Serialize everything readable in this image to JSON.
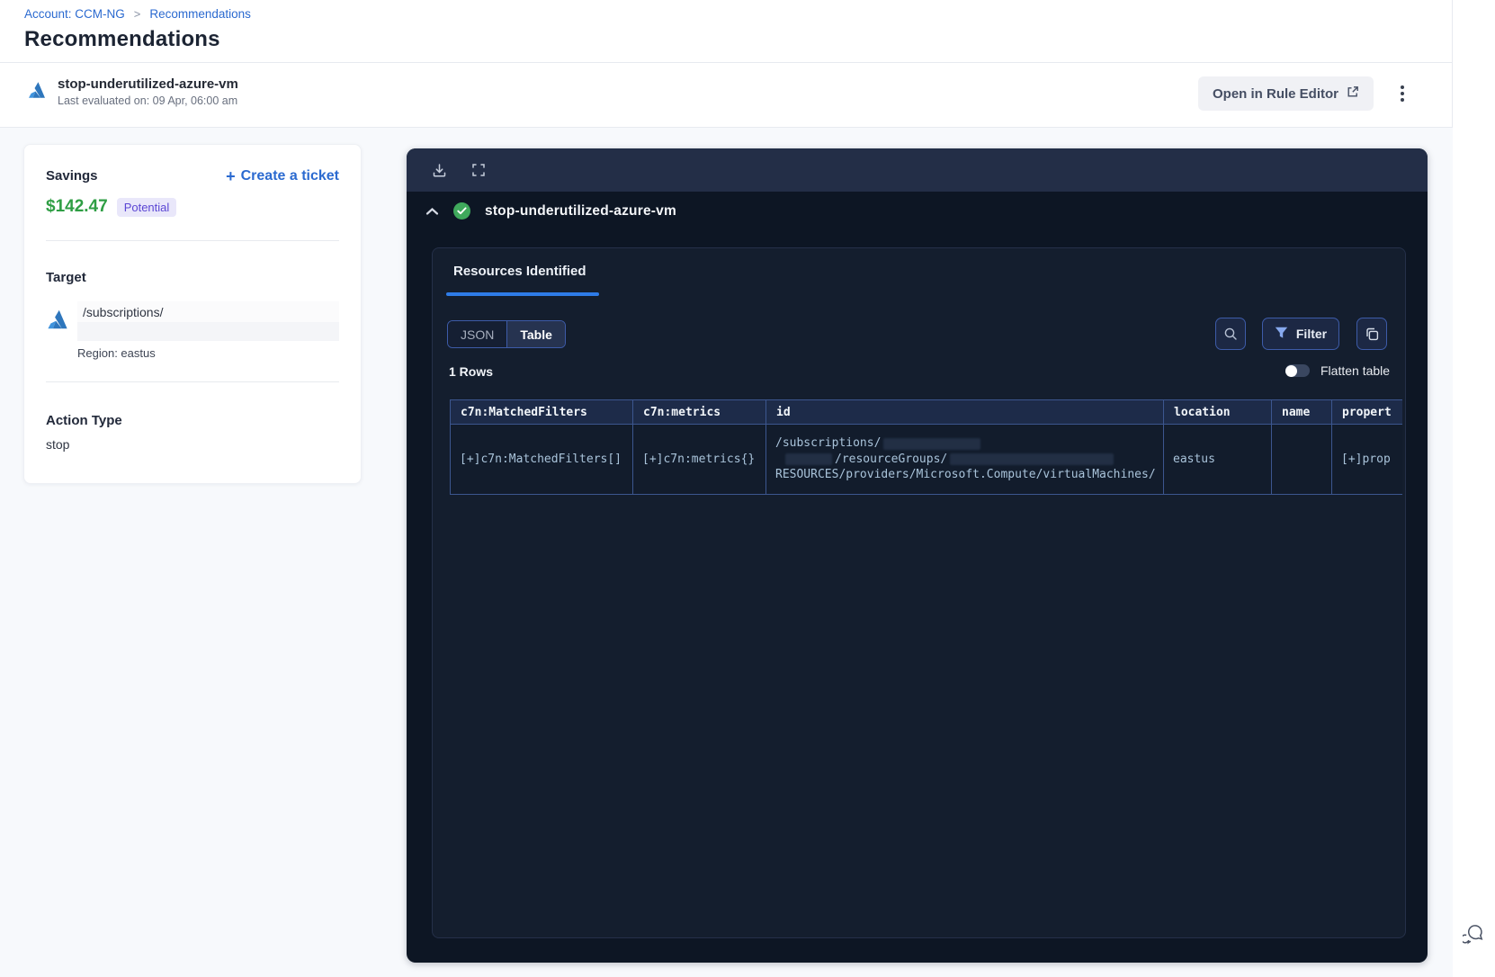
{
  "breadcrumb": {
    "account": "Account: CCM-NG",
    "separator": ">",
    "page": "Recommendations"
  },
  "page_title": "Recommendations",
  "rule_header": {
    "title": "stop-underutilized-azure-vm",
    "subtitle": "Last evaluated on: 09 Apr, 06:00 am",
    "open_button": "Open in Rule Editor"
  },
  "sidebar": {
    "savings_label": "Savings",
    "plus": "+",
    "create_ticket_label": "Create a ticket",
    "amount": "$142.47",
    "badge": "Potential",
    "target_label": "Target",
    "target_path": "/subscriptions/",
    "region": "Region: eastus",
    "action_type_label": "Action Type",
    "action_type_value": "stop"
  },
  "panel": {
    "rule_title": "stop-underutilized-azure-vm",
    "tab_label": "Resources Identified",
    "json_label": "JSON",
    "table_label": "Table",
    "filter_label": "Filter",
    "rows_label": "1 Rows",
    "flatten_label": "Flatten table",
    "table": {
      "columns": [
        "c7n:MatchedFilters",
        "c7n:metrics",
        "id",
        "location",
        "name",
        "propert"
      ],
      "row": {
        "matched_filters": "[+]c7n:MatchedFilters[]",
        "metrics": "[+]c7n:metrics{}",
        "id_line1": "/subscriptions/",
        "id_line2": "/resourceGroups/",
        "id_line3": "RESOURCES/providers/Microsoft.Compute/virtualMachines/",
        "location": "eastus",
        "name": "",
        "properties": "[+]prop"
      }
    }
  },
  "colors": {
    "accent_blue": "#2B6AD0",
    "savings_green": "#2F9E44",
    "badge_purple": "#5B46D4",
    "panel_bg": "#0D1624",
    "tab_indicator": "#2E7CE8",
    "status_green": "#3FA95C"
  }
}
